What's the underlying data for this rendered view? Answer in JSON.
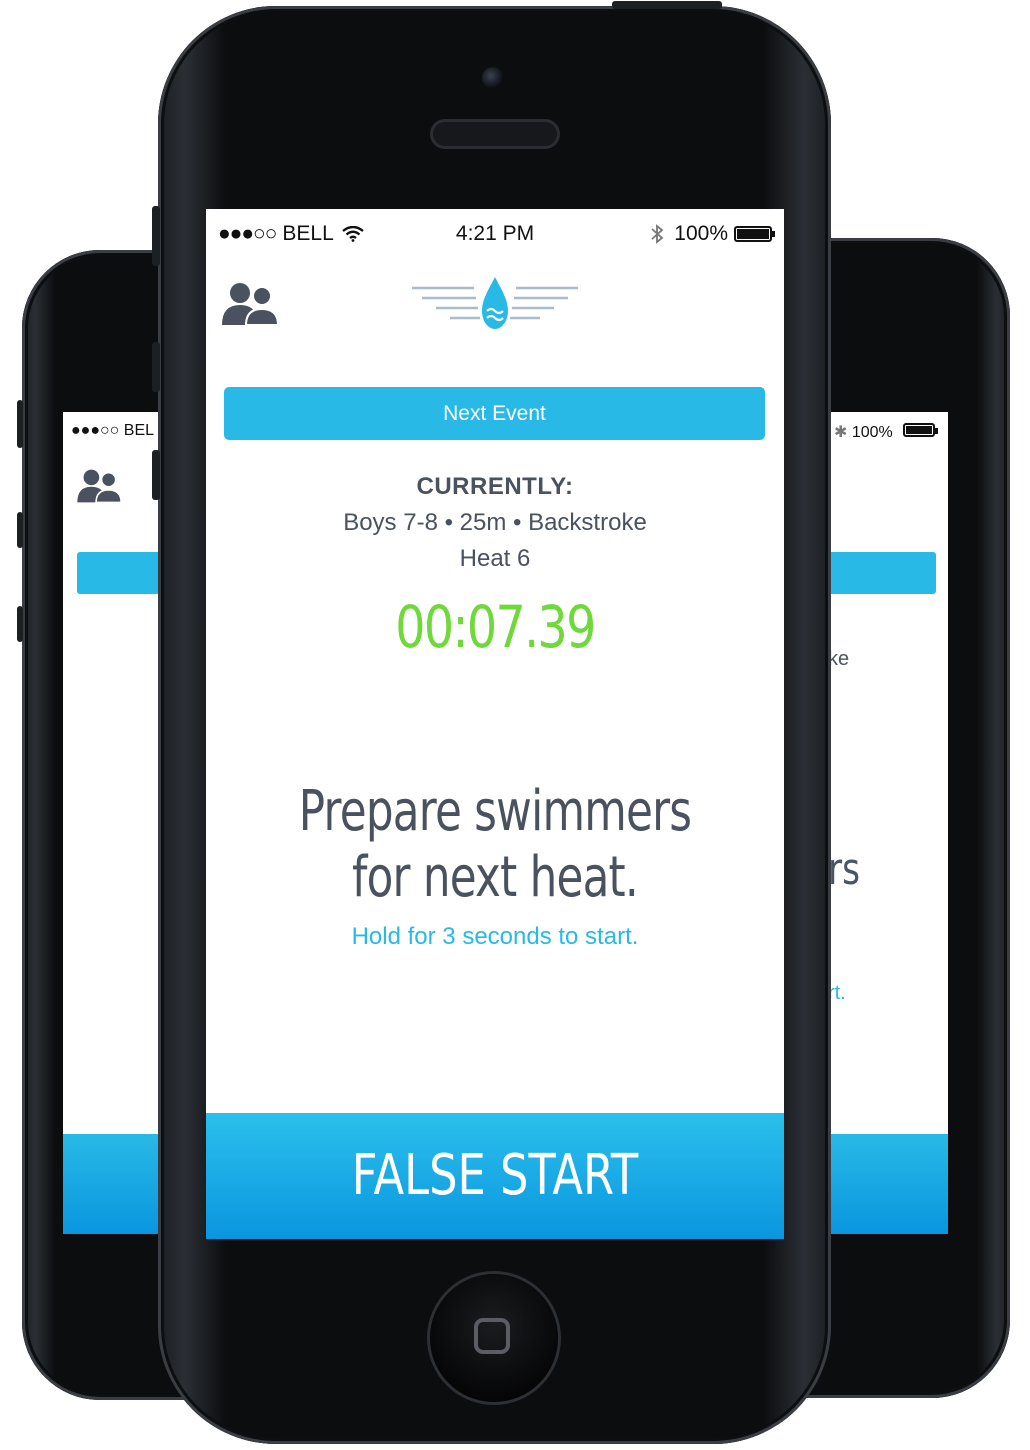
{
  "status_bar": {
    "signal": "●●●○○",
    "carrier": "BELL",
    "time": "4:21 PM",
    "battery": "100%",
    "wifi_icon": "wifi-icon",
    "bluetooth_icon": "bluetooth-icon"
  },
  "back_left": {
    "carrier": "●●●○○ BEL"
  },
  "back_right": {
    "battery": "100%",
    "event_fragment": "ke",
    "prepare_fragment": "rs",
    "hold_fragment": "rt."
  },
  "header": {
    "swimmers_icon": "swimmers-icon",
    "logo_icon": "water-drop-logo-icon"
  },
  "main": {
    "next_event_label": "Next Event",
    "currently_label": "CURRENTLY:",
    "event_description": "Boys 7-8 • 25m • Backstroke",
    "heat": "Heat 6",
    "timer": "00:07.39",
    "prepare_line1": "Prepare swimmers",
    "prepare_line2": "for next heat.",
    "hold_instruction": "Hold for 3 seconds to start."
  },
  "footer": {
    "false_start_label": "FALSE START"
  },
  "colors": {
    "accent_blue": "#29b9e6",
    "timer_green": "#6fd83b",
    "text_gray": "#4a5260"
  }
}
